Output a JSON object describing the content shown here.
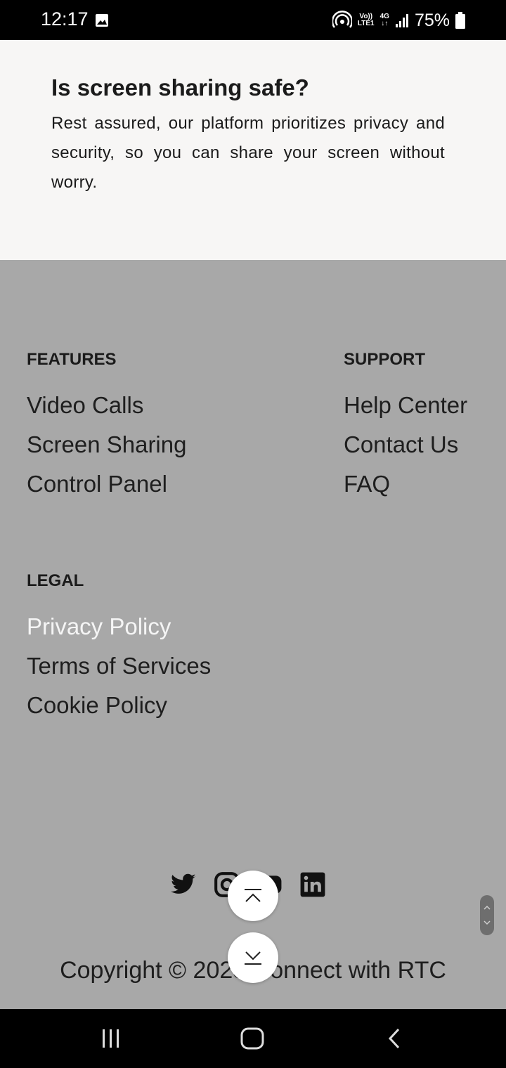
{
  "status_bar": {
    "time": "12:17",
    "net_top": "Vo))",
    "net_bottom": "LTE1",
    "net_type": "4G",
    "battery": "75%"
  },
  "faq": {
    "title": "Is screen sharing safe?",
    "body": "Rest assured, our platform prioritizes privacy and security, so you can share your screen without worry."
  },
  "footer": {
    "features": {
      "heading": "FEATURES",
      "links": [
        "Video Calls",
        "Screen Sharing",
        "Control Panel"
      ]
    },
    "support": {
      "heading": "SUPPORT",
      "links": [
        "Help Center",
        "Contact Us",
        "FAQ"
      ]
    },
    "legal": {
      "heading": "LEGAL",
      "links": [
        "Privacy Policy",
        "Terms of Services",
        "Cookie Policy"
      ]
    },
    "social_icons": [
      "twitter-icon",
      "instagram-icon",
      "youtube-icon",
      "linkedin-icon"
    ],
    "copyright": "Copyright © 2023 Connect with RTC"
  },
  "colors": {
    "footer_bg": "#a8a8a8",
    "faq_bg": "#f7f6f5",
    "active_link": "#f5f5f5"
  }
}
